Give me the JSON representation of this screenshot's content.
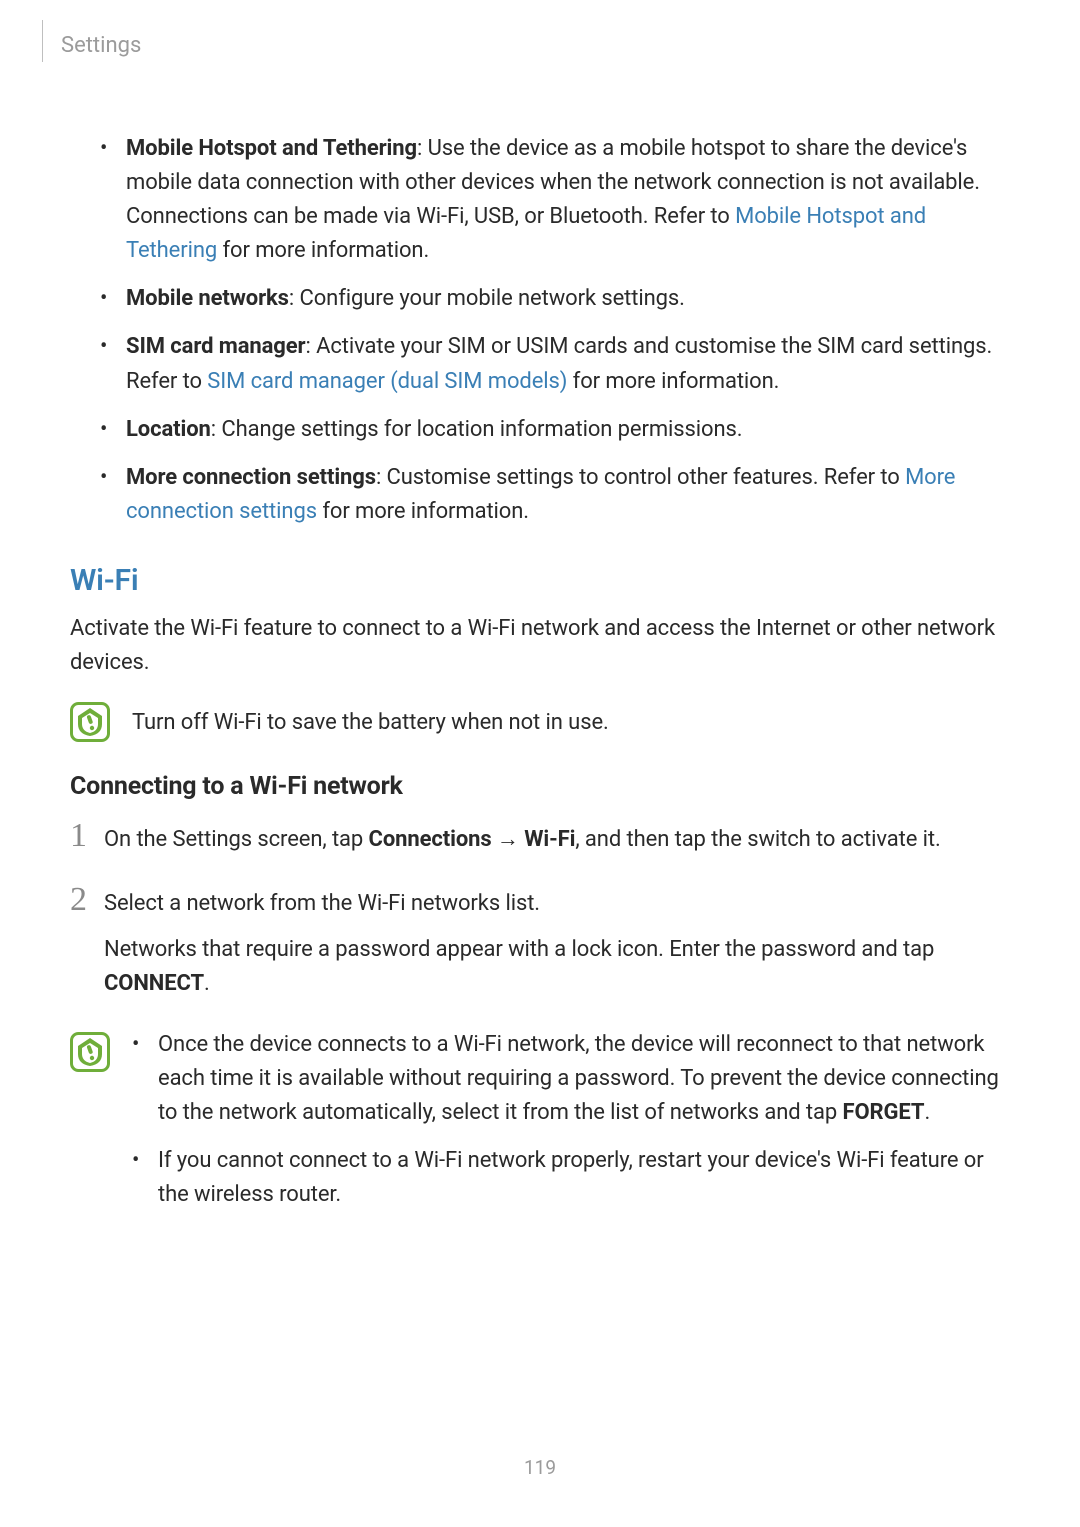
{
  "header": {
    "section": "Settings"
  },
  "bullets_top": [
    {
      "bold": "Mobile Hotspot and Tethering",
      "rest_a": ": Use the device as a mobile hotspot to share the device's mobile data connection with other devices when the network connection is not available. Connections can be made via Wi-Fi, USB, or Bluetooth. Refer to ",
      "link": "Mobile Hotspot and Tethering",
      "rest_b": " for more information."
    },
    {
      "bold": "Mobile networks",
      "rest_a": ": Configure your mobile network settings.",
      "link": "",
      "rest_b": ""
    },
    {
      "bold": "SIM card manager",
      "rest_a": ": Activate your SIM or USIM cards and customise the SIM card settings. Refer to ",
      "link": "SIM card manager (dual SIM models)",
      "rest_b": " for more information."
    },
    {
      "bold": "Location",
      "rest_a": ": Change settings for location information permissions.",
      "link": "",
      "rest_b": ""
    },
    {
      "bold": "More connection settings",
      "rest_a": ": Customise settings to control other features. Refer to ",
      "link": "More connection settings",
      "rest_b": " for more information."
    }
  ],
  "wifi": {
    "heading": "Wi-Fi",
    "intro": "Activate the Wi-Fi feature to connect to a Wi-Fi network and access the Internet or other network devices.",
    "tip": "Turn off Wi-Fi to save the battery when not in use.",
    "sub": "Connecting to a Wi-Fi network",
    "steps": {
      "s1": {
        "num": "1",
        "a": "On the Settings screen, tap ",
        "b1": "Connections",
        "arrow": " → ",
        "b2": "Wi-Fi",
        "c": ", and then tap the switch to activate it."
      },
      "s2": {
        "num": "2",
        "a": "Select a network from the Wi-Fi networks list.",
        "b": "Networks that require a password appear with a lock icon. Enter the password and tap ",
        "b_bold": "CONNECT",
        "c": "."
      }
    },
    "notes": {
      "n1a": "Once the device connects to a Wi-Fi network, the device will reconnect to that network each time it is available without requiring a password. To prevent the device connecting to the network automatically, select it from the list of networks and tap ",
      "n1b": "FORGET",
      "n1c": ".",
      "n2": "If you cannot connect to a Wi-Fi network properly, restart your device's Wi-Fi feature or the wireless router."
    }
  },
  "page_number": "119"
}
